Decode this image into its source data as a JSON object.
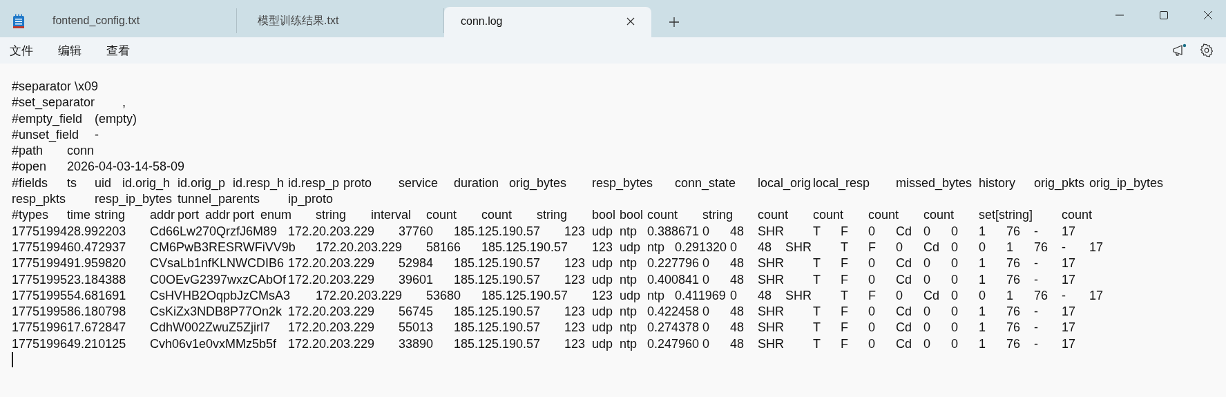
{
  "tabs": [
    {
      "label": "fontend_config.txt",
      "selected": false
    },
    {
      "label": "模型训练结果.txt",
      "selected": false
    },
    {
      "label": "conn.log",
      "selected": true
    }
  ],
  "menu": [
    "文件",
    "编辑",
    "查看"
  ],
  "lines": [
    "#separator \\x09",
    "#set_separator\t,",
    "#empty_field\t(empty)",
    "#unset_field\t-",
    "#path\tconn",
    "#open\t2026-04-03-14-58-09",
    "#fields\tts\tuid\tid.orig_h\tid.orig_p\tid.resp_h\tid.resp_p\tproto\tservice\tduration\torig_bytes\tresp_bytes\tconn_state\tlocal_orig\tlocal_resp\tmissed_bytes\thistory\torig_pkts\torig_ip_bytes\tresp_pkts\tresp_ip_bytes\ttunnel_parents\tip_proto",
    "#types\ttime\tstring\taddr\tport\taddr\tport\tenum\tstring\tinterval\tcount\tcount\tstring\tbool\tbool\tcount\tstring\tcount\tcount\tcount\tcount\tset[string]\tcount",
    "1775199428.992203\tCd66Lw270QrzfJ6M89\t172.20.203.229\t37760\t185.125.190.57\t123\tudp\tntp\t0.388671\t0\t48\tSHR\tT\tF\t0\tCd\t0\t0\t1\t76\t-\t17",
    "1775199460.472937\tCM6PwB3RESRWFiVV9b\t172.20.203.229\t58166\t185.125.190.57\t123\tudp\tntp\t0.291320\t0\t48\tSHR\tT\tF\t0\tCd\t0\t0\t1\t76\t-\t17",
    "1775199491.959820\tCVsaLb1nfKLNWCDIB6\t172.20.203.229\t52984\t185.125.190.57\t123\tudp\tntp\t0.227796\t0\t48\tSHR\tT\tF\t0\tCd\t0\t0\t1\t76\t-\t17",
    "1775199523.184388\tC0OEvG2397wxzCAbOf\t172.20.203.229\t39601\t185.125.190.57\t123\tudp\tntp\t0.400841\t0\t48\tSHR\tT\tF\t0\tCd\t0\t0\t1\t76\t-\t17",
    "1775199554.681691\tCsHVHB2OqpbJzCMsA3\t172.20.203.229\t53680\t185.125.190.57\t123\tudp\tntp\t0.411969\t0\t48\tSHR\tT\tF\t0\tCd\t0\t0\t1\t76\t-\t17",
    "1775199586.180798\tCsKiZx3NDB8P77On2k\t172.20.203.229\t56745\t185.125.190.57\t123\tudp\tntp\t0.422458\t0\t48\tSHR\tT\tF\t0\tCd\t0\t0\t1\t76\t-\t17",
    "1775199617.672847\tCdhW002ZwuZ5Zjirl7\t172.20.203.229\t55013\t185.125.190.57\t123\tudp\tntp\t0.274378\t0\t48\tSHR\tT\tF\t0\tCd\t0\t0\t1\t76\t-\t17",
    "1775199649.210125\tCvh06v1e0vxMMz5b5f\t172.20.203.229\t33890\t185.125.190.57\t123\tudp\tntp\t0.247960\t0\t48\tSHR\tT\tF\t0\tCd\t0\t0\t1\t76\t-\t17"
  ]
}
